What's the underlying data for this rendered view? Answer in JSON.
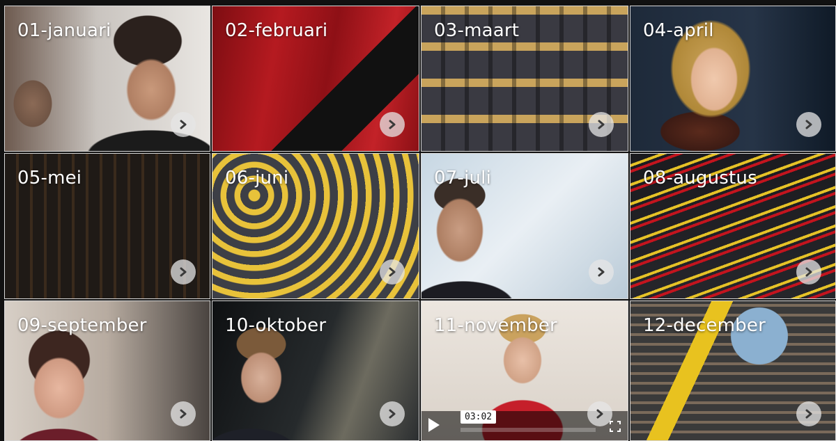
{
  "tiles": [
    {
      "label": "01-januari"
    },
    {
      "label": "02-februari"
    },
    {
      "label": "03-maart"
    },
    {
      "label": "04-april"
    },
    {
      "label": "05-mei"
    },
    {
      "label": "06-juni"
    },
    {
      "label": "07-juli"
    },
    {
      "label": "08-augustus"
    },
    {
      "label": "09-september"
    },
    {
      "label": "10-oktober"
    },
    {
      "label": "11-november"
    },
    {
      "label": "12-december"
    }
  ],
  "video": {
    "timestamp": "03:02"
  },
  "icons": {
    "tile_action": "chevron-right-icon",
    "video_play": "play-icon",
    "video_fullscreen": "fullscreen-icon"
  },
  "colors": {
    "arrow_circle": "#e6e6e6",
    "arrow_glyph": "#3a3a3a",
    "label_text": "#ffffff"
  }
}
